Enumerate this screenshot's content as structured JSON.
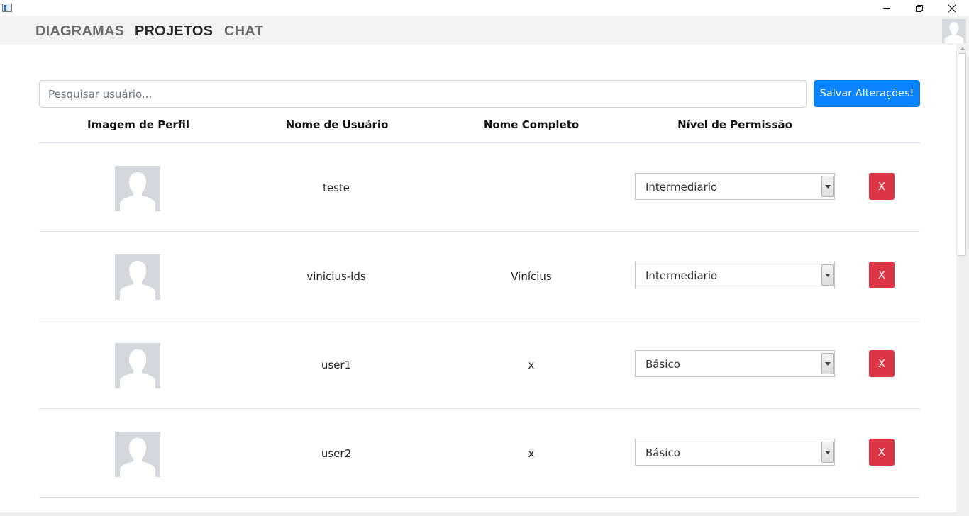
{
  "nav": {
    "items": [
      {
        "label": "DIAGRAMAS",
        "active": false
      },
      {
        "label": "PROJETOS",
        "active": true
      },
      {
        "label": "CHAT",
        "active": false
      }
    ],
    "avatar_icon": "default-user-avatar-icon"
  },
  "window_controls": {
    "minimize_icon": "minimize-icon",
    "maximize_icon": "restore-icon",
    "close_icon": "close-icon"
  },
  "search": {
    "placeholder": "Pesquisar usuário...",
    "value": ""
  },
  "save_button": {
    "label": "Salvar Alterações!",
    "color": "#0d84ff"
  },
  "table": {
    "headers": {
      "image": "Imagem de Perfil",
      "username": "Nome de Usuário",
      "fullname": "Nome Completo",
      "permission": "Nível de Permissão"
    },
    "rows": [
      {
        "avatar_icon": "default-user-avatar-icon",
        "username": "teste",
        "fullname": "",
        "permission": "Intermediario",
        "delete_label": "X"
      },
      {
        "avatar_icon": "default-user-avatar-icon",
        "username": "vinicius-lds",
        "fullname": "Vinícius",
        "permission": "Intermediario",
        "delete_label": "X"
      },
      {
        "avatar_icon": "default-user-avatar-icon",
        "username": "user1",
        "fullname": "x",
        "permission": "Básico",
        "delete_label": "X"
      },
      {
        "avatar_icon": "default-user-avatar-icon",
        "username": "user2",
        "fullname": "x",
        "permission": "Básico",
        "delete_label": "X"
      }
    ]
  },
  "colors": {
    "delete": "#dc3545",
    "primary": "#0d84ff"
  }
}
